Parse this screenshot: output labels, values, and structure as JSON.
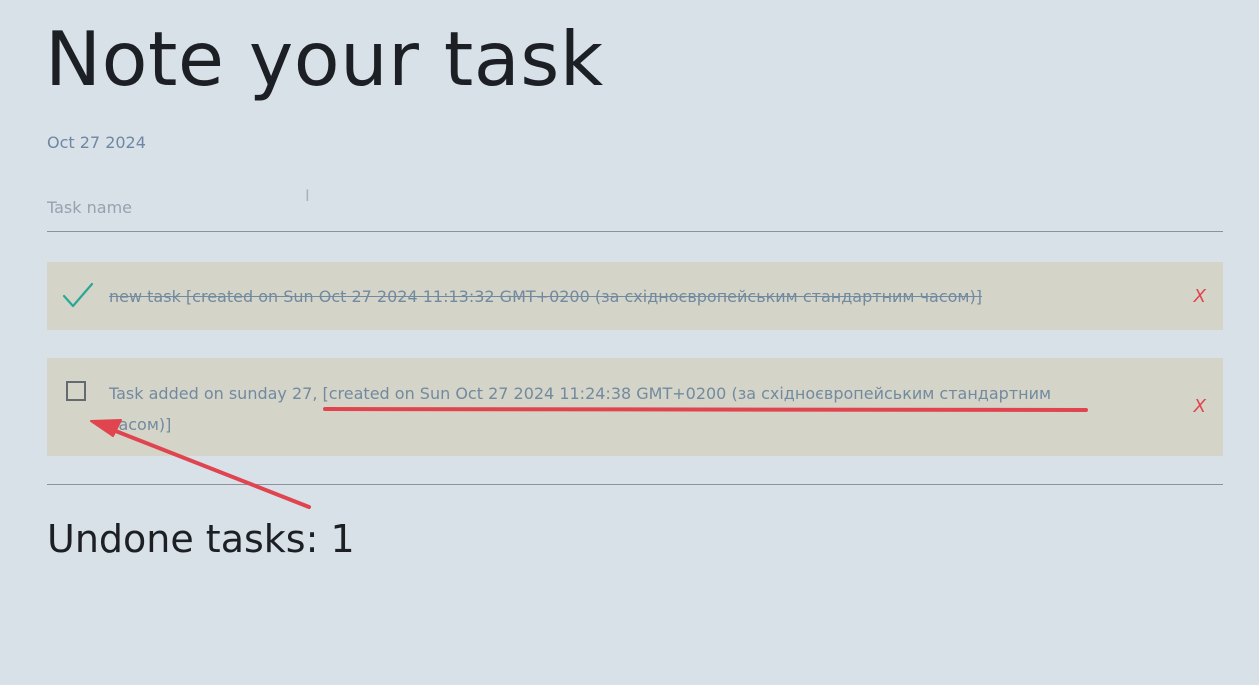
{
  "header": {
    "title": "Note your task",
    "date": "Oct 27 2024"
  },
  "input": {
    "placeholder": "Task name",
    "value": ""
  },
  "tasks": [
    {
      "text": "new task [created on Sun Oct 27 2024 11:13:32 GMT+0200 (за східноєвропейським стандартним часом)]",
      "done": true,
      "delete_label": "X"
    },
    {
      "text": "Task added on sunday 27, [created on Sun Oct 27 2024 11:24:38 GMT+0200 (за східноєвропейським стандартним часом)]",
      "done": false,
      "delete_label": "X"
    }
  ],
  "summary": {
    "undone_label": "Undone tasks: 1"
  },
  "colors": {
    "background": "#d8e0e8",
    "task_background": "#d4d4c8",
    "task_text": "#728aa0",
    "check": "#2aa894",
    "delete": "#e0454f",
    "annotation": "#e0454f"
  },
  "icons": {
    "done": "check-icon",
    "not_done": "checkbox"
  }
}
